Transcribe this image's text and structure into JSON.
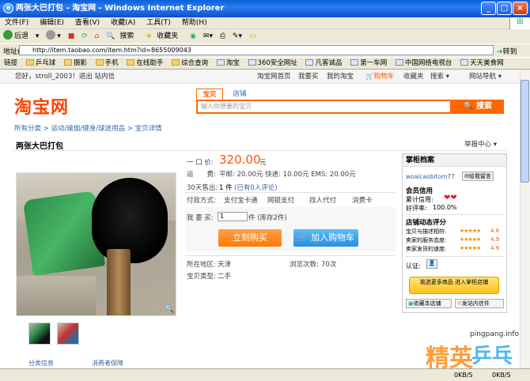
{
  "window": {
    "title": "两张大巴打包 - 淘宝网 - Windows Internet Explorer"
  },
  "menu": [
    "文件(F)",
    "编辑(E)",
    "查看(V)",
    "收藏(A)",
    "工具(T)",
    "帮助(H)"
  ],
  "toolbar": {
    "back": "后退",
    "search": "搜索",
    "favorites": "收藏夹"
  },
  "address": {
    "label": "地址(D)",
    "url": "http://item.taobao.com/item.htm?id=8655009043",
    "go": "转到"
  },
  "links": {
    "label": "链接",
    "items": [
      "乒乓球",
      "摄影",
      "手机",
      "在线助手",
      "综合查询",
      "淘宝",
      "360安全网址",
      "凡客诚品",
      "第一车网",
      "中国网络电视台",
      "天天美食网"
    ]
  },
  "site": {
    "greeting": "您好，stroll_2003！退出 站内信",
    "topnav": [
      "淘宝网首页",
      "我要买",
      "我的淘宝",
      "购物车",
      "收藏夹",
      "搜索",
      "网站导航"
    ],
    "logo": "淘宝网",
    "search_tabs": [
      "宝贝",
      "店铺"
    ],
    "search_placeholder": "输入你想要的宝贝",
    "search_btn": "搜索",
    "breadcrumb": "所有分类 > 运动/瑜伽/健身/球迷用品 > 宝贝详情",
    "report": "举报中心"
  },
  "item": {
    "title": "两张大巴打包",
    "price_label": "一 口 价:",
    "price": "320.00",
    "price_unit": "元",
    "ship_label": "运　　费:",
    "ship": "平邮: 20.00元 快递: 10.00元 EMS: 20.00元",
    "sold_label": "30天售出:",
    "sold": "1 件",
    "reviews": "(已有0人评论)",
    "pay_label": "付款方式:",
    "pay": [
      "支付宝卡通",
      "网银支付",
      "找人代付",
      "消费卡"
    ],
    "qty_label": "我 要 买:",
    "qty": "1",
    "stock": "件 (库存2件)",
    "buy_btn": "立刻购买",
    "cart_btn": "加入购物车",
    "loc_label": "所在地区:",
    "loc": "天津",
    "views_label": "浏览次数:",
    "views": "70次",
    "type_label": "宝贝类型:",
    "type": "二手"
  },
  "seller": {
    "header": "掌柜档案",
    "name": "woaicaobitom77",
    "msg": "给我留言",
    "credit_title": "会员信用",
    "credit_label": "累计信用:",
    "rate_label": "好评率:",
    "rate": "100.0%",
    "shop_title": "店铺动态评分",
    "scores": [
      {
        "label": "宝贝与描述相符:",
        "v": "4.8"
      },
      {
        "label": "卖家的服务态度:",
        "v": "4.9"
      },
      {
        "label": "卖家发货的速度:",
        "v": "4.9"
      }
    ],
    "cert_label": "认证:",
    "promo": "挑选更多商品 进入掌柜店铺",
    "fav_shop": "收藏本店铺",
    "inbox": "发站内信件"
  },
  "bottom": {
    "more": "分类信息",
    "store": "消费者保障"
  },
  "watermark": {
    "site": "pingpang.info",
    "cn1": "精英",
    "cn2": "乒乓网"
  },
  "status": {
    "speed1": "0KB/S",
    "speed2": "0KB/S"
  }
}
